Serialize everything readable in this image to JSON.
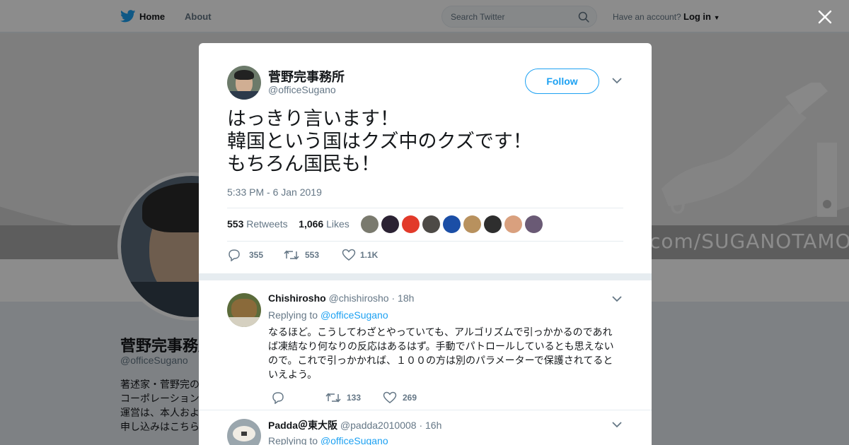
{
  "nav": {
    "home": "Home",
    "about": "About",
    "search_placeholder": "Search Twitter",
    "have_account": "Have an account?",
    "login": "Log in"
  },
  "banner": {
    "url_text": "com/SUGANOTAMOTSU"
  },
  "profile": {
    "name": "菅野完事務所",
    "handle": "@officeSugano",
    "bio_lines": [
      "著述家・菅野完の",
      "コーポレーション",
      "運営は、本人およ",
      "申し込みはこちら"
    ]
  },
  "tweet": {
    "author_name": "菅野完事務所",
    "author_handle": "@officeSugano",
    "follow_label": "Follow",
    "text_lines": [
      "はっきり言います！",
      "韓国という国はクズ中のクズです！",
      "もちろん国民も！"
    ],
    "timestamp": "5:33 PM - 6 Jan 2019",
    "retweets_count": "553",
    "retweets_label": "Retweets",
    "likes_count": "1,066",
    "likes_label": "Likes",
    "liker_colors": [
      "#7a7a6e",
      "#2b2233",
      "#e23a2a",
      "#4d4a46",
      "#1b4ea6",
      "#b8915e",
      "#2e2e2e",
      "#d9a07e",
      "#6a5a75"
    ],
    "reply_count": "355",
    "retweet_count": "553",
    "like_count": "1.1K"
  },
  "replies": [
    {
      "name": "Chishirosho",
      "handle": "@chishirosho",
      "age": "· 18h",
      "replying_prefix": "Replying to",
      "replying_to": "@officeSugano",
      "text": "なるほど。こうしてわざとやっていても、アルゴリズムで引っかかるのであれば凍結なり何なりの反応はあるはず。手動でパトロールしているとも思えないので。これで引っかかれば、１００の方は別のパラメーターで保護されてるといえよう。",
      "reply_count": "",
      "retweet_count": "133",
      "like_count": "269"
    },
    {
      "name": "Padda＠東大阪",
      "handle": "@padda2010008",
      "age": "· 16h",
      "replying_prefix": "Replying to",
      "replying_to": "@officeSugano"
    }
  ]
}
